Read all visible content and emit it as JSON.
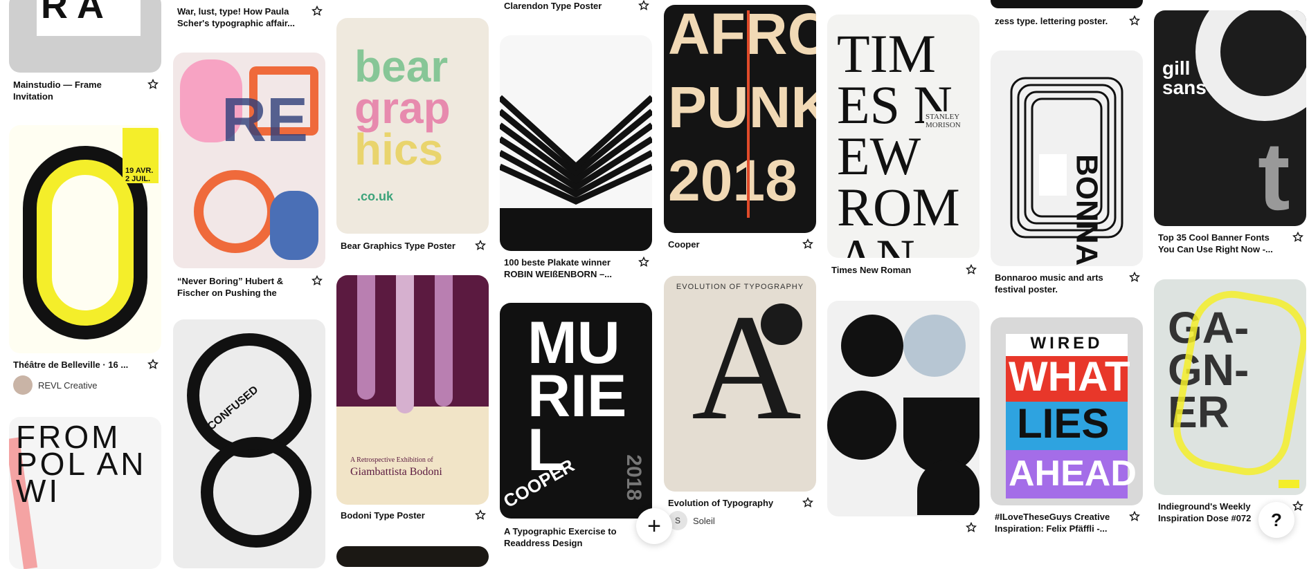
{
  "pins": {
    "c1p1": {
      "title": "Mainstudio — Frame Invitation"
    },
    "c1p2": {
      "title": "Théâtre de Belleville · 16 ...",
      "author": "REVL Creative",
      "poster": {
        "title_letters": "FROM POL AN WI",
        "date_text": "19 AVR. 2 JUIL."
      }
    },
    "c1p3": {
      "title": ""
    },
    "c2p1": {
      "title": "War, lust, type! How Paula Scher's typographic affair..."
    },
    "c2p2": {
      "title": "“Never Boring” Hubert & Fischer on Pushing the Lim..."
    },
    "c2p3": {
      "poster_word": "CONFUSED"
    },
    "c3p1": {
      "title": "Bear Graphics Type Poster",
      "poster": {
        "line1": "bear",
        "line2": "grap",
        "line3": "hics",
        "url": ".co.uk"
      }
    },
    "c3p2": {
      "title": "Bodoni Type Poster",
      "poster": {
        "caption": "A Retrospective Exhibition of",
        "name": "Giambattista Bodoni"
      }
    },
    "c4p1": {
      "title": "Clarendon Type Poster"
    },
    "c4p2": {
      "title": "100 beste Plakate winner ROBIN WEIßENBORN –..."
    },
    "c4p3": {
      "title": "A Typographic Exercise to Readdress Design History's...",
      "poster": {
        "word": "MURIEL",
        "side": "COOPER",
        "year": "2018"
      }
    },
    "c5p1": {
      "title": "Cooper",
      "poster": {
        "line1": "AFRO",
        "line2": "PUNK",
        "line3": "2018"
      }
    },
    "c5p2": {
      "title": "Evolution of Typography",
      "author": "Soleil",
      "author_initial": "S",
      "poster": {
        "heading": "EVOLUTION OF TYPOGRAPHY",
        "letter": "A"
      }
    },
    "c6p1": {
      "title": "Times New Roman",
      "poster": {
        "letters": "TIMES NEW ROMAN",
        "name": "STANLEY MORISON"
      }
    },
    "c6p2": {
      "title": ""
    },
    "c7p1": {
      "title": "zess type. lettering poster."
    },
    "c7p2": {
      "title": "Bonnaroo music and arts festival poster.",
      "poster": {
        "word": "BONNAROO"
      }
    },
    "c7p3": {
      "title": "#ILoveTheseGuys Creative Inspiration: Felix Pfäffli -...",
      "poster": {
        "brand": "WIRED",
        "l1": "WHAT",
        "l2": "LIES",
        "l3": "AHEAD"
      }
    },
    "c8p1": {
      "title": "Top 35 Cool Banner Fonts You Can Use Right Now -...",
      "poster": {
        "word": "gill sans"
      }
    },
    "c8p2": {
      "title": "Indieground's Weekly Inspiration Dose #072",
      "poster": {
        "word": "GA-GN-ER"
      }
    }
  },
  "fab": {
    "create": "+",
    "help": "?"
  },
  "colors": {
    "yellow": "#f4ee2a",
    "red": "#e8372a",
    "wine": "#5b1a40",
    "cream": "#f1e4c7"
  }
}
